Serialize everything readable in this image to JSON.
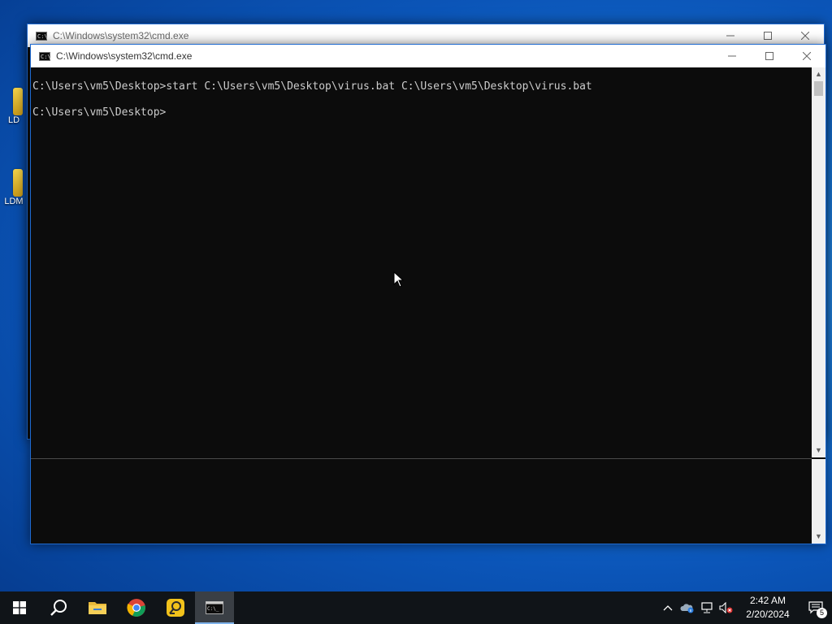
{
  "desktop": {
    "icons": [
      {
        "label": "LD"
      },
      {
        "label": "LDM"
      }
    ]
  },
  "windows": {
    "back": {
      "title": "C:\\Windows\\system32\\cmd.exe"
    },
    "front": {
      "title": "C:\\Windows\\system32\\cmd.exe",
      "console_lines": [
        "C:\\Users\\vm5\\Desktop>start C:\\Users\\vm5\\Desktop\\virus.bat C:\\Users\\vm5\\Desktop\\virus.bat",
        "C:\\Users\\vm5\\Desktop>"
      ]
    },
    "controls": {
      "minimize": "—",
      "maximize": "☐",
      "close": "✕"
    }
  },
  "taskbar": {
    "apps": [
      {
        "name": "start-button",
        "icon": "windows-logo-icon"
      },
      {
        "name": "search-button",
        "icon": "search-icon"
      },
      {
        "name": "file-explorer",
        "icon": "folder-icon"
      },
      {
        "name": "chrome",
        "icon": "chrome-icon"
      },
      {
        "name": "ldplayer",
        "icon": "ldplayer-icon"
      },
      {
        "name": "cmd",
        "icon": "cmd-icon",
        "state": "active"
      }
    ],
    "tray": {
      "time": "2:42 AM",
      "date": "2/20/2024",
      "notification_count": "5"
    }
  },
  "colors": {
    "console_bg": "#0c0c0c",
    "console_text": "#cccccc",
    "taskbar_bg": "#101418",
    "accent": "#7fb2ea"
  }
}
